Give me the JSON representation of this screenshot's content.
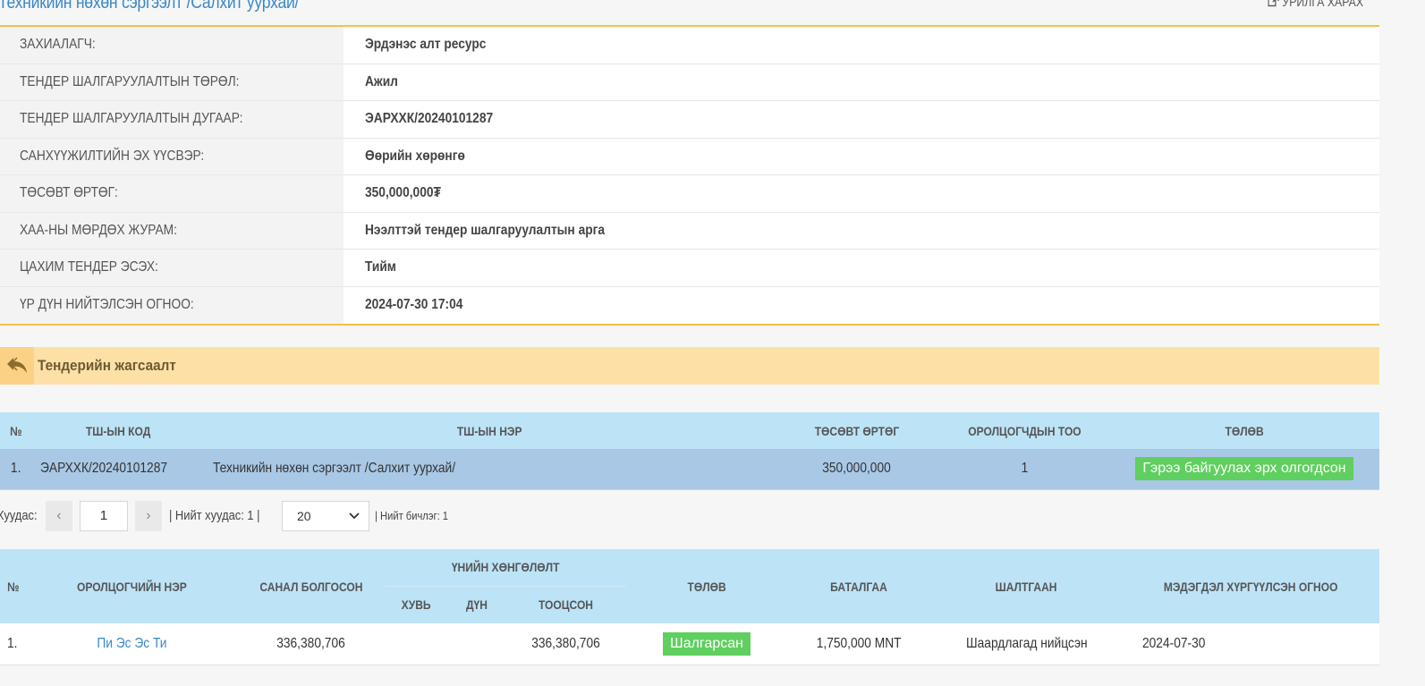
{
  "header": {
    "title": "Техникийн нөхөн сэргээлт /Салхит уурхай/",
    "preview_label": "УРИЛГА ХАРАХ"
  },
  "info": [
    {
      "label": "ЗАХИАЛАГЧ:",
      "value": "Эрдэнэс алт ресурс"
    },
    {
      "label": "ТЕНДЕР ШАЛГАРУУЛАЛТЫН ТӨРӨЛ:",
      "value": "Ажил"
    },
    {
      "label": "ТЕНДЕР ШАЛГАРУУЛАЛТЫН ДУГААР:",
      "value": "ЭАРХХК/20240101287"
    },
    {
      "label": "САНХҮҮЖИЛТИЙН ЭХ ҮҮСВЭР:",
      "value": "Өөрийн хөрөнгө"
    },
    {
      "label": "ТӨСӨВТ ӨРТӨГ:",
      "value": "350,000,000₮"
    },
    {
      "label": "ХАА-НЫ МӨРДӨХ ЖУРАМ:",
      "value": "Нээлттэй тендер шалгаруулалтын арга"
    },
    {
      "label": "ЦАХИМ ТЕНДЕР ЭСЭХ:",
      "value": "Тийм"
    },
    {
      "label": "ҮР ДҮН НИЙТЭЛСЭН ОГНОО:",
      "value": "2024-07-30 17:04"
    }
  ],
  "summary": {
    "title": "Тендерийн жагсаалт"
  },
  "packages": {
    "headers": {
      "no": "№",
      "code": "ТШ-ЫН КОД",
      "name": "ТШ-ЫН НЭР",
      "budget": "ТӨСӨВТ ӨРТӨГ",
      "bidders": "ОРОЛЦОГЧДЫН ТОО",
      "status": "ТӨЛӨВ"
    },
    "rows": [
      {
        "no": "1.",
        "code": "ЭАРХХК/20240101287",
        "name": "Техникийн нөхөн сэргээлт /Салхит уурхай/",
        "budget": "350,000,000",
        "bidders": "1",
        "status": "Гэрээ байгуулах эрх олгогдсон"
      }
    ]
  },
  "pager": {
    "page_label": "Хуудас:",
    "prev": "‹",
    "page_value": "1",
    "next": "›",
    "total_pages": "| Нийт хуудас: 1  |",
    "page_size": "20",
    "total_records": "|  Нийт бичлэг: 1"
  },
  "participants": {
    "headers": {
      "no": "№",
      "name": "ОРОЛЦОГЧИЙН НЭР",
      "offer": "САНАЛ БОЛГОСОН",
      "discount_group": "ҮНИЙН ХӨНГӨЛӨЛТ",
      "percent": "ХУВЬ",
      "amount": "ДҮН",
      "calculated": "ТООЦСОН",
      "status": "ТӨЛӨВ",
      "guarantee": "БАТАЛГАА",
      "reason": "ШАЛТГААН",
      "notice_date": "МЭДЭГДЭЛ ХҮРГҮҮЛСЭН ОГНОО"
    },
    "rows": [
      {
        "no": "1.",
        "name": "Пи Эс Эс Ти",
        "offer": "336,380,706",
        "percent": "",
        "amount": "",
        "calculated": "336,380,706",
        "status": "Шалгарсан",
        "guarantee": "1,750,000 MNT",
        "reason": "Шаардлагад нийцсэн",
        "notice_date": "2024-07-30"
      }
    ]
  },
  "colors": {
    "accent": "#f5c049",
    "title_blue": "#3a87c8",
    "header_blue": "#bde3f7",
    "status_green": "#5fcf5f"
  }
}
